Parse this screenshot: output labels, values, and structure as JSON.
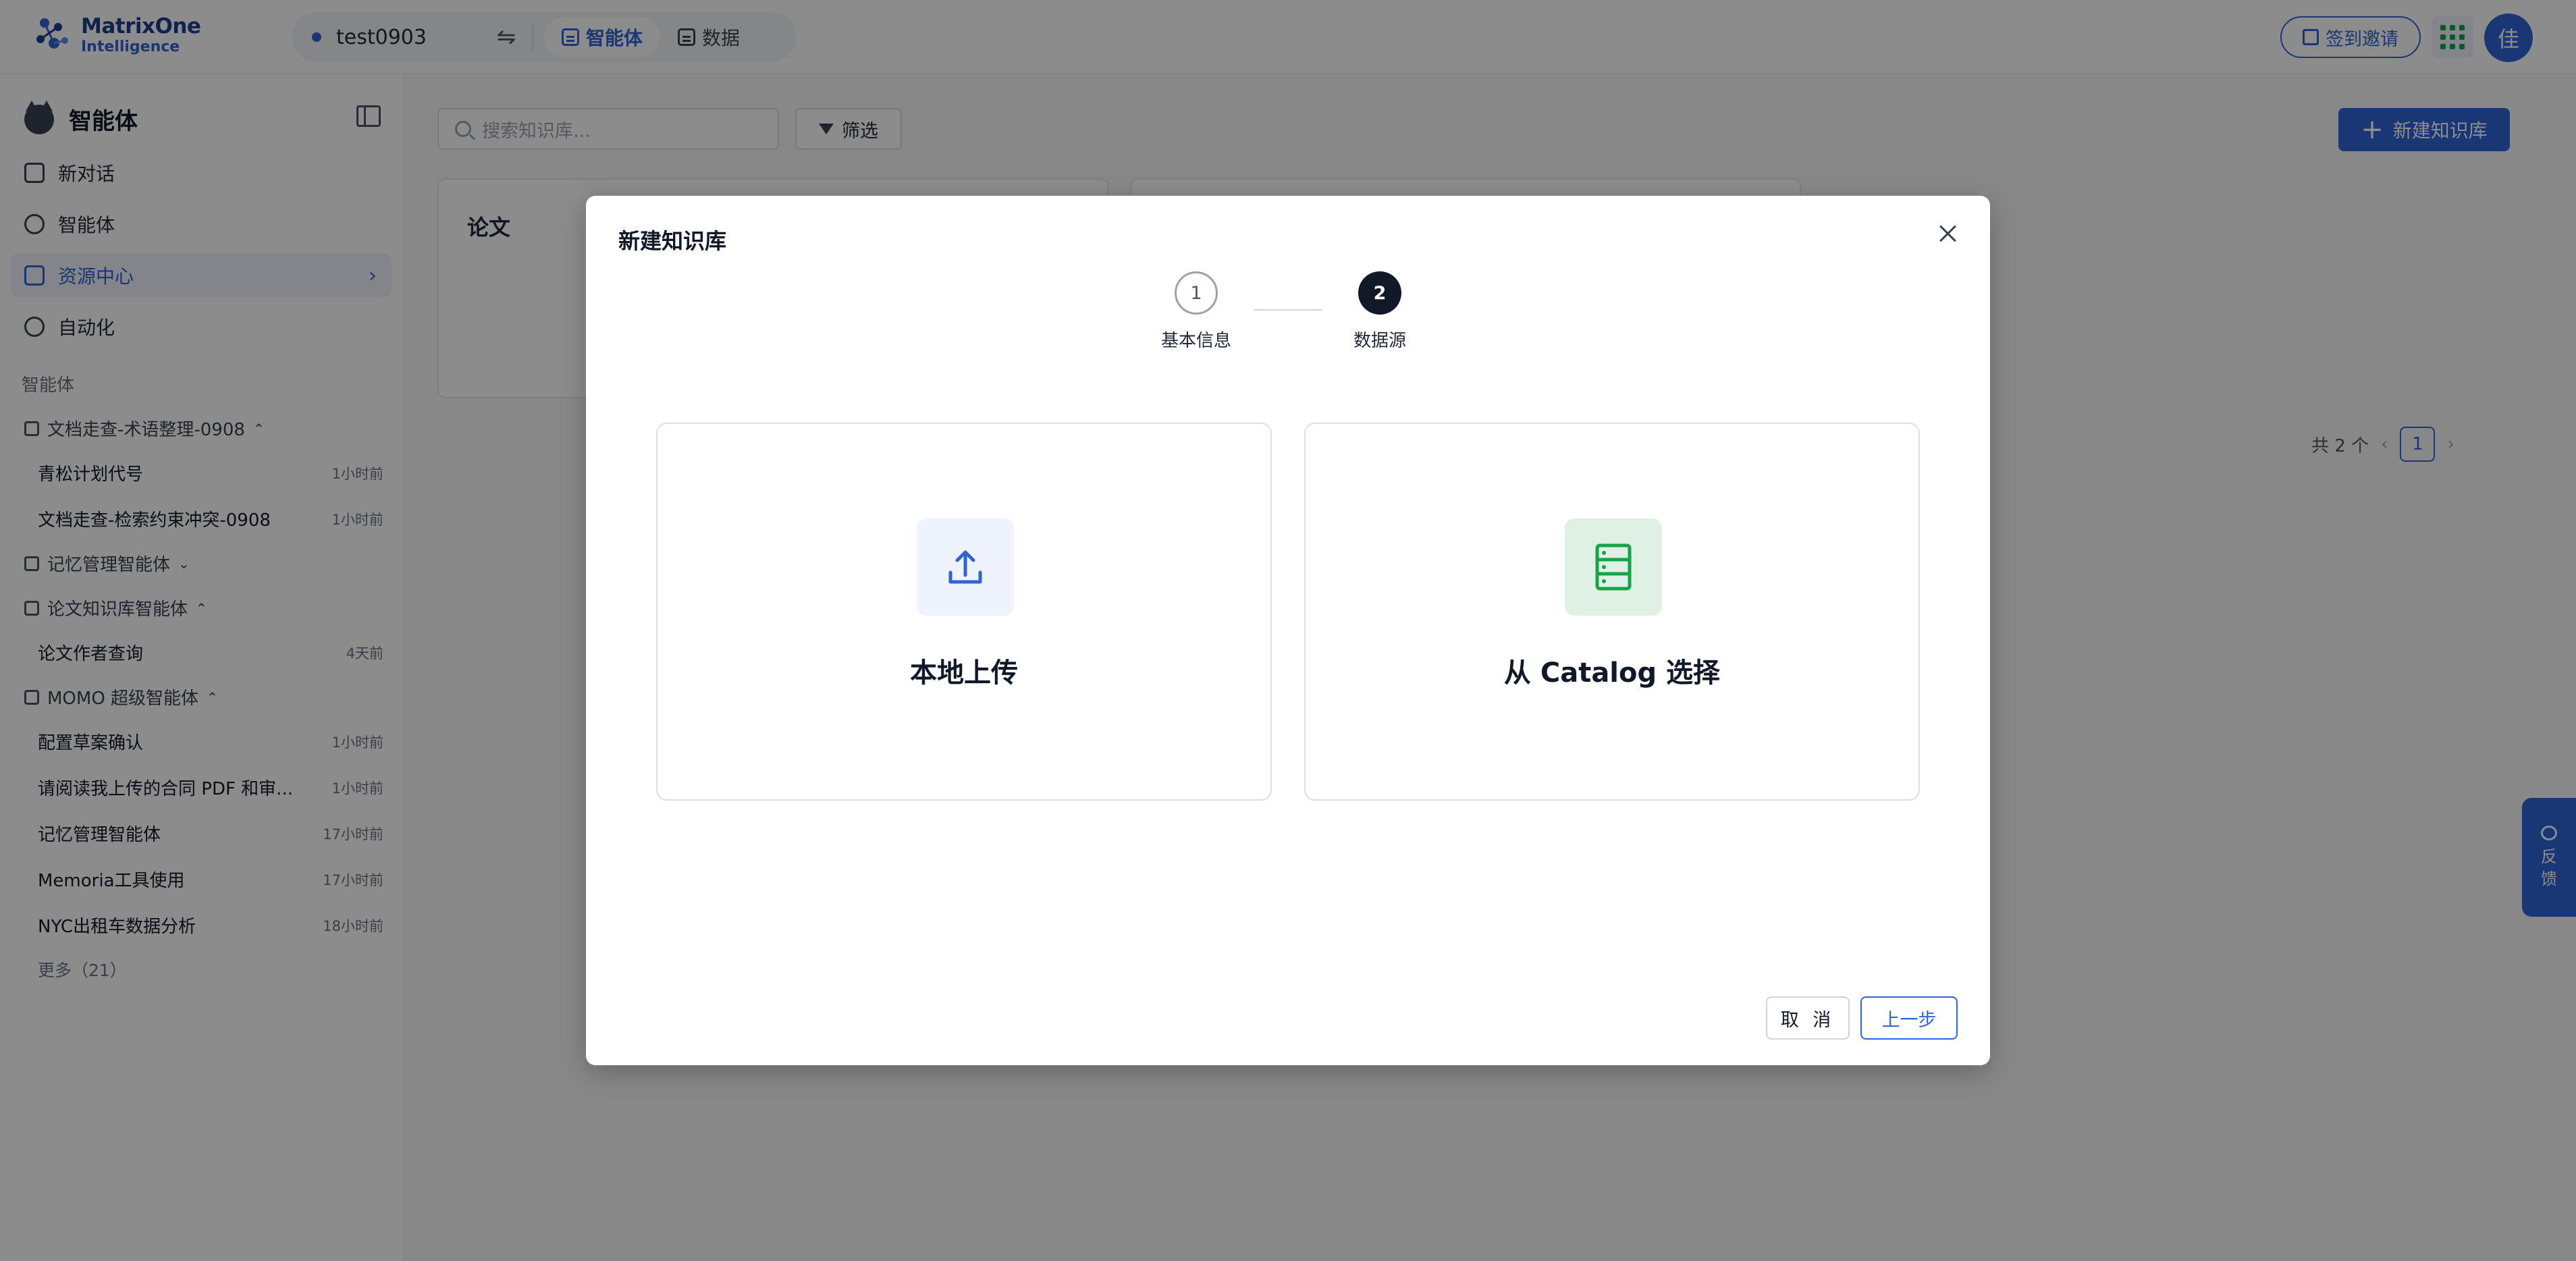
{
  "brand": {
    "line1": "MatrixOne",
    "line2": "Intelligence"
  },
  "workspace": {
    "name": "test0903",
    "tabs": [
      {
        "label": "智能体",
        "active": true
      },
      {
        "label": "数据",
        "active": false
      }
    ]
  },
  "header": {
    "invite_label": "签到邀请",
    "avatar_text": "佳"
  },
  "sidebar": {
    "title": "智能体",
    "nav": [
      {
        "label": "新对话",
        "icon": "chat-icon"
      },
      {
        "label": "智能体",
        "icon": "agent-icon"
      },
      {
        "label": "资源中心",
        "icon": "grid-icon",
        "active": true
      },
      {
        "label": "自动化",
        "icon": "clock-icon"
      }
    ],
    "section_label": "智能体",
    "groups": [
      {
        "name": "文档走查-术语整理-0908",
        "expanded": true,
        "items": [
          {
            "title": "青松计划代号",
            "time": "1小时前"
          },
          {
            "title": "文档走查-检索约束冲突-0908",
            "time": "1小时前"
          }
        ]
      },
      {
        "name": "记忆管理智能体",
        "expanded": false,
        "items": []
      },
      {
        "name": "论文知识库智能体",
        "expanded": true,
        "items": [
          {
            "title": "论文作者查询",
            "time": "4天前"
          }
        ]
      },
      {
        "name": "MOMO 超级智能体",
        "expanded": true,
        "items": [
          {
            "title": "配置草案确认",
            "time": "1小时前"
          },
          {
            "title": "请阅读我上传的合同 PDF 和审...",
            "time": "1小时前"
          },
          {
            "title": "记忆管理智能体",
            "time": "17小时前"
          },
          {
            "title": "Memoria工具使用",
            "time": "17小时前"
          },
          {
            "title": "NYC出租车数据分析",
            "time": "18小时前"
          }
        ]
      }
    ],
    "more_label": "更多（21）"
  },
  "main": {
    "search_placeholder": "搜索知识库...",
    "filter_label": "筛选",
    "new_button_label": "新建知识库",
    "cards": [
      {
        "title": "论文"
      },
      {
        "title": ""
      }
    ],
    "pagination": {
      "total_text": "共 2 个",
      "current_page": "1"
    }
  },
  "feedback": {
    "char1": "反",
    "char2": "馈"
  },
  "modal": {
    "title": "新建知识库",
    "steps": [
      {
        "number": "1",
        "label": "基本信息",
        "state": "done"
      },
      {
        "number": "2",
        "label": "数据源",
        "state": "current"
      }
    ],
    "options": [
      {
        "label": "本地上传",
        "icon": "upload-icon",
        "tile_color": "#eef3fd"
      },
      {
        "label": "从 Catalog 选择",
        "icon": "database-icon",
        "tile_color": "#dff0e4"
      }
    ],
    "cancel_label": "取 消",
    "prev_label": "上一步"
  },
  "colors": {
    "accent": "#2f63d6",
    "overlay": "rgba(0,0,0,0.45)",
    "dark": "#111827",
    "success": "#16a34a"
  }
}
